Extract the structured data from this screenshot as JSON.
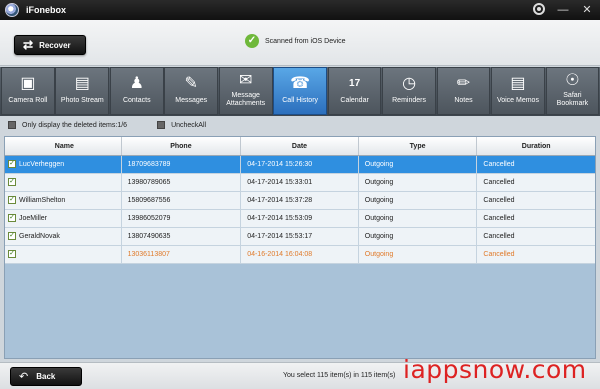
{
  "app": {
    "title": "iFonebox"
  },
  "header": {
    "recover_label": "Recover",
    "status_text": "Scanned from iOS Device"
  },
  "tabs": [
    {
      "label": "Camera Roll",
      "icon": "camera-icon"
    },
    {
      "label": "Photo Stream",
      "icon": "photo-icon"
    },
    {
      "label": "Contacts",
      "icon": "contact-icon"
    },
    {
      "label": "Messages",
      "icon": "message-icon"
    },
    {
      "label": "Message Attachments",
      "icon": "attachment-icon"
    },
    {
      "label": "Call History",
      "icon": "phone-icon",
      "active": true
    },
    {
      "label": "Calendar",
      "icon": "calendar-icon"
    },
    {
      "label": "Reminders",
      "icon": "clock-icon"
    },
    {
      "label": "Notes",
      "icon": "notes-icon"
    },
    {
      "label": "Voice Memos",
      "icon": "voice-memo-icon"
    },
    {
      "label": "Safari Bookmark",
      "icon": "compass-icon"
    }
  ],
  "filters": {
    "deleted_only_label": "Only display the deleted items:1/6",
    "uncheck_all_label": "UncheckAll"
  },
  "table": {
    "columns": [
      "Name",
      "Phone",
      "Date",
      "Type",
      "Duration"
    ],
    "rows": [
      {
        "name": "LucVerheggen",
        "phone": "18709683789",
        "date": "04-17-2014 15:26:30",
        "type": "Outgoing",
        "duration": "Cancelled",
        "selected": true
      },
      {
        "name": "",
        "phone": "13980789065",
        "date": "04-17-2014 15:33:01",
        "type": "Outgoing",
        "duration": "Cancelled"
      },
      {
        "name": "WilliamShelton",
        "phone": "15809687556",
        "date": "04-17-2014 15:37:28",
        "type": "Outgoing",
        "duration": "Cancelled"
      },
      {
        "name": "JoeMiller",
        "phone": "13986052079",
        "date": "04-17-2014 15:53:09",
        "type": "Outgoing",
        "duration": "Cancelled"
      },
      {
        "name": "GeraldNovak",
        "phone": "13807490635",
        "date": "04-17-2014 15:53:17",
        "type": "Outgoing",
        "duration": "Cancelled"
      },
      {
        "name": "",
        "phone": "13036113807",
        "date": "04-16-2014 16:04:08",
        "type": "Outgoing",
        "duration": "Cancelled",
        "deleted": true
      }
    ]
  },
  "footer": {
    "back_label": "Back",
    "selection_text": "You select 115 item(s) in 115 item(s)"
  },
  "watermark": "iappsnow.com",
  "colors": {
    "accent": "#2f8fe0",
    "deleted_text": "#e07a2a",
    "check_green": "#6fb83b"
  }
}
